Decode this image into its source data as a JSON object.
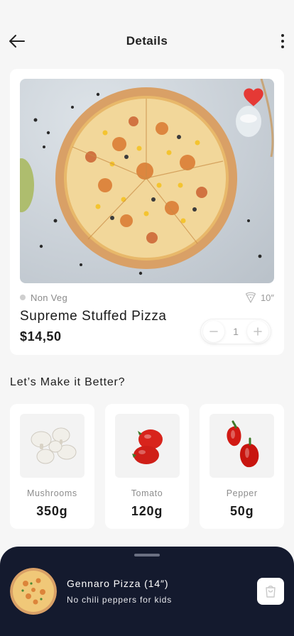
{
  "header": {
    "title": "Details",
    "back_icon": "arrow-left-icon",
    "menu_icon": "more-vertical-icon"
  },
  "product": {
    "diet": "Non Veg",
    "size": "10″",
    "name": "Supreme Stuffed Pizza",
    "price": "$14,50",
    "quantity": "1",
    "favorited": true
  },
  "section": {
    "title": "Let’s Make it Better?"
  },
  "toppings": [
    {
      "name": "Mushrooms",
      "weight": "350g"
    },
    {
      "name": "Tomato",
      "weight": "120g"
    },
    {
      "name": "Pepper",
      "weight": "50g"
    }
  ],
  "cart_sheet": {
    "title": "Gennaro Pizza (14″)",
    "subtitle": "No chili peppers for kids",
    "cart_icon": "shopping-bag-icon"
  },
  "colors": {
    "background": "#f6f6f6",
    "card": "#ffffff",
    "sheet": "#141a2e",
    "heart": "#e53935",
    "muted_text": "#8d8d8d"
  }
}
